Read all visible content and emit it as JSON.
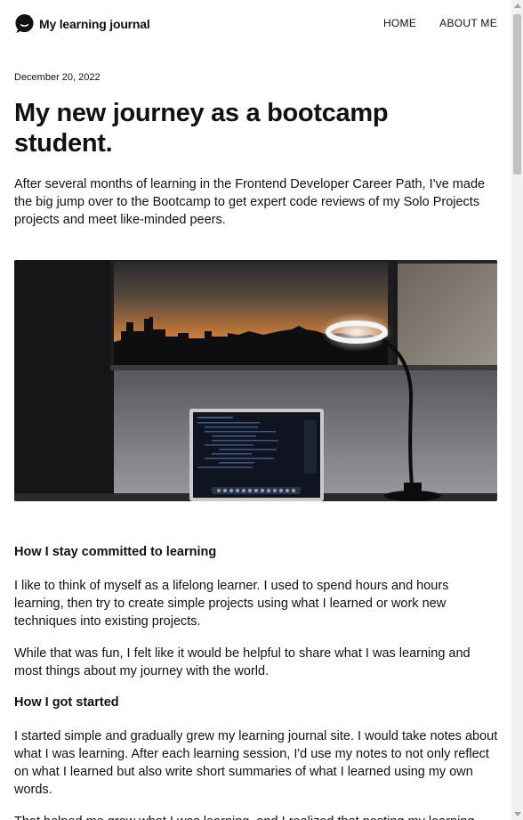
{
  "header": {
    "site_title": "My learning journal",
    "logo_icon": "chat-bubble-icon",
    "nav": [
      {
        "label": "HOME"
      },
      {
        "label": "ABOUT ME"
      }
    ]
  },
  "article": {
    "date": "December 20, 2022",
    "title": "My new journey as a bootcamp student.",
    "intro": "After several months of learning in the Frontend Developer Career Path, I've made the big jump over to the Bootcamp to get expert code reviews of my Solo Projects projects and meet like-minded peers.",
    "hero_image": "laptop-on-desk-with-ring-lamp-at-sunset-window",
    "sections": [
      {
        "heading": "How I stay committed to learning",
        "paragraphs": [
          "I like to think of myself as a lifelong learner. I used to spend hours and hours learning, then try to create simple projects using what I learned or work new techniques into existing projects.",
          "While that was fun, I felt like it would be helpful to share what I was learning and most things about my journey with the world."
        ]
      },
      {
        "heading": "How I got started",
        "paragraphs": [
          "I started simple and gradually grew my learning journal site. I would take notes about what I was learning. After each learning session, I'd use my notes to not only reflect on what I learned but also write short summaries of what I learned using my own words.",
          "That helped me grow what I was learning, and I realized that posting my learning"
        ]
      }
    ]
  },
  "colors": {
    "text": "#111111",
    "background": "#ffffff",
    "scrollbar_track": "#f1f1f1",
    "scrollbar_thumb": "#c1c1c1"
  }
}
